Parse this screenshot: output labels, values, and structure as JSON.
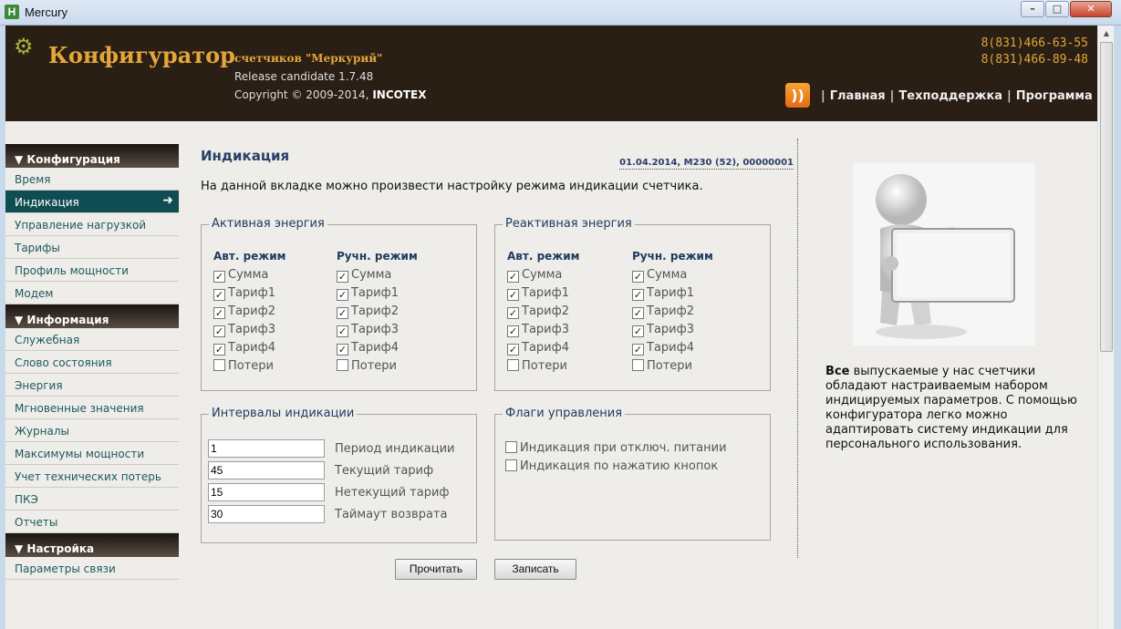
{
  "window": {
    "title": "Mercury",
    "icon_letter": "H",
    "min": "–",
    "max": "□",
    "close": "✕"
  },
  "header": {
    "app_name": "Конфигуратор",
    "subtitle": "счетчиков \"Меркурий\"",
    "release": "Release candidate 1.7.48",
    "copyright_prefix": "Copyright © 2009-2014, ",
    "copyright_company": "INCOTEX",
    "phones": [
      "8(831)466-63-55",
      "8(831)466-89-48"
    ],
    "nav": [
      "Главная",
      "Техподдержка",
      "Программа"
    ]
  },
  "sidebar": {
    "sections": [
      {
        "title": "▼ Конфигурация",
        "items": [
          "Время",
          "Индикация",
          "Управление нагрузкой",
          "Тарифы",
          "Профиль мощности",
          "Модем"
        ]
      },
      {
        "title": "▼ Информация",
        "items": [
          "Служебная",
          "Слово состояния",
          "Энергия",
          "Мгновенные значения",
          "Журналы",
          "Максимумы мощности",
          "Учет технических потерь",
          "ПКЭ",
          "Отчеты"
        ]
      },
      {
        "title": "▼ Настройка",
        "items": [
          "Параметры связи"
        ]
      }
    ],
    "active_item": "Индикация"
  },
  "main": {
    "title": "Индикация",
    "device_info": "01.04.2014, М230 (52), 00000001",
    "intro": "На данной вкладке можно произвести настройку режима индикации счетчика.",
    "active_energy": {
      "legend": "Активная энергия",
      "auto_head": "Авт. режим",
      "manual_head": "Ручн. режим"
    },
    "reactive_energy": {
      "legend": "Реактивная энергия",
      "auto_head": "Авт. режим",
      "manual_head": "Ручн. режим"
    },
    "check_labels": [
      "Сумма",
      "Тариф1",
      "Тариф2",
      "Тариф3",
      "Тариф4",
      "Потери"
    ],
    "check_states": [
      true,
      true,
      true,
      true,
      true,
      false
    ],
    "intervals": {
      "legend": "Интервалы индикации",
      "rows": [
        {
          "value": "1",
          "label": "Период индикации"
        },
        {
          "value": "45",
          "label": "Текущий тариф"
        },
        {
          "value": "15",
          "label": "Нетекущий тариф"
        },
        {
          "value": "30",
          "label": "Таймаут возврата"
        }
      ]
    },
    "flags": {
      "legend": "Флаги управления",
      "items": [
        {
          "label": "Индикация при отключ. питании",
          "checked": false
        },
        {
          "label": "Индикация по нажатию кнопок",
          "checked": false
        }
      ]
    },
    "buttons": {
      "read": "Прочитать",
      "write": "Записать"
    }
  },
  "info": {
    "bold": "Все",
    "text": " выпускаемые у нас счетчики обладают настраиваемым набором индицируемых параметров. С помощью конфигуратора легко можно адаптировать систему индикации для персонального использования."
  }
}
